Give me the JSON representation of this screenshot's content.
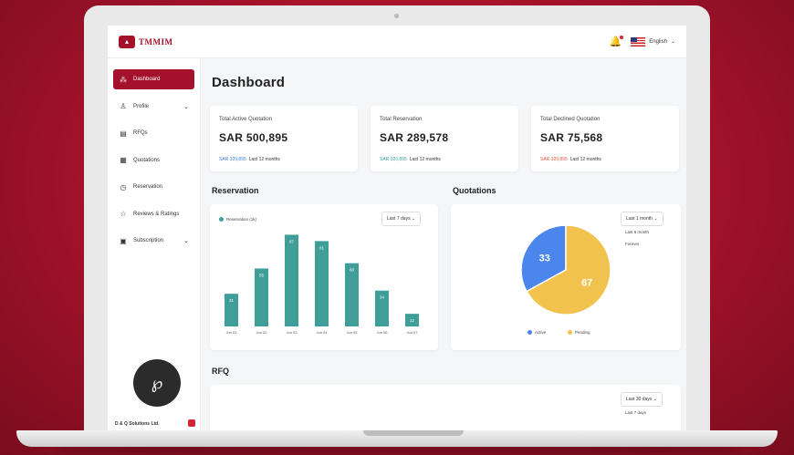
{
  "app": {
    "logo_text": "TMMIM",
    "language": "English"
  },
  "sidebar": {
    "items": [
      {
        "label": "Dashboard",
        "icon": "grid-icon"
      },
      {
        "label": "Profile",
        "icon": "user-icon"
      },
      {
        "label": "RFQs",
        "icon": "document-icon"
      },
      {
        "label": "Quotations",
        "icon": "file-icon"
      },
      {
        "label": "Reservation",
        "icon": "clock-icon"
      },
      {
        "label": "Reviews & Ratings",
        "icon": "star-icon"
      },
      {
        "label": "Subscription",
        "icon": "card-icon"
      }
    ],
    "company": "D & Q Solutions Ltd."
  },
  "page": {
    "title": "Dashboard"
  },
  "stats": [
    {
      "label": "Total Active Quotation",
      "value": "SAR 500,895",
      "highlight": "SAR 320,895",
      "period": "Last 12 months",
      "color": "#3b7ddd"
    },
    {
      "label": "Total Reservation",
      "value": "SAR 289,578",
      "highlight": "SAR 320,895",
      "period": "Last 12 months",
      "color": "#3aa0a0"
    },
    {
      "label": "Total Declined Quotation",
      "value": "SAR 75,568",
      "highlight": "SAR 320,895",
      "period": "Last 12 months",
      "color": "#e0563e"
    }
  ],
  "reservation": {
    "title": "Reservation",
    "filter": "Last 7 days",
    "legend": "Reservation (1k)"
  },
  "quotations": {
    "title": "Quotations",
    "filter": "Last 1 month",
    "options": [
      "Last 6 month",
      "Forever"
    ]
  },
  "rfq": {
    "title": "RFQ",
    "filter": "Last 30 days",
    "options": [
      "Last 7 days"
    ]
  },
  "chart_data": [
    {
      "type": "bar",
      "categories": [
        "Jun 01",
        "Jun 02",
        "Jun 03",
        "Jun 04",
        "Jun 05",
        "Jun 06",
        "Jun 07"
      ],
      "series": [
        {
          "name": "Reservation (1k)",
          "values": [
            31,
            55,
            87,
            81,
            60,
            34,
            12
          ],
          "color": "#3f9e98"
        }
      ]
    },
    {
      "type": "pie",
      "categories": [
        "Active",
        "Pending"
      ],
      "values": [
        33,
        67
      ],
      "colors": [
        "#4a86ec",
        "#f2c24e"
      ]
    }
  ]
}
